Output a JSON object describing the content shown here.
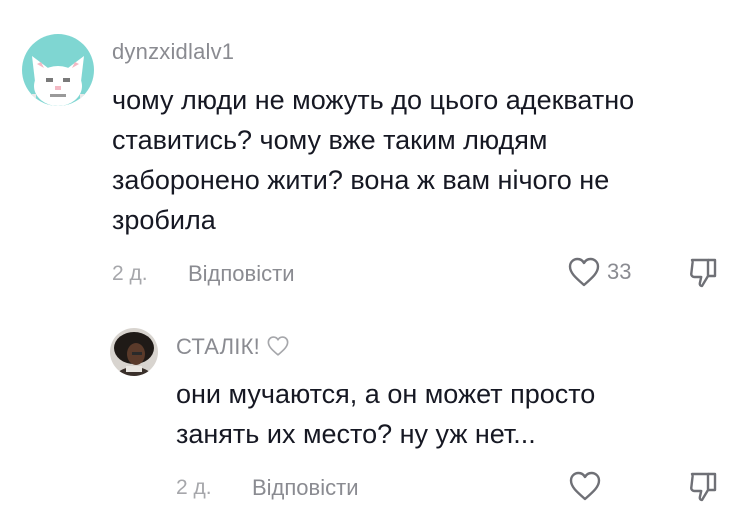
{
  "comments": [
    {
      "username": "dynzxidlalv1",
      "avatar_icon": "white-cat-avatar-icon",
      "text": "чому люди не можуть до цього адекватно\nставитись? чому вже таким людям\nзаборонено жити? вона ж вам нічого не\nзробила",
      "time": "2 д.",
      "reply_label": "Відповісти",
      "likes": "33"
    }
  ],
  "replies": [
    {
      "username": "СТАЛІК!",
      "avatar_icon": "dark-portrait-avatar-icon",
      "text": "они мучаются, а он может просто\nзанять их место? ну уж нет...",
      "time": "2 д.",
      "reply_label": "Відповісти"
    }
  ],
  "colors": {
    "text": "#161823",
    "secondary": "#8a8b91",
    "muted": "#a6a7ab",
    "avatar_bg": "#7fd6d2"
  }
}
